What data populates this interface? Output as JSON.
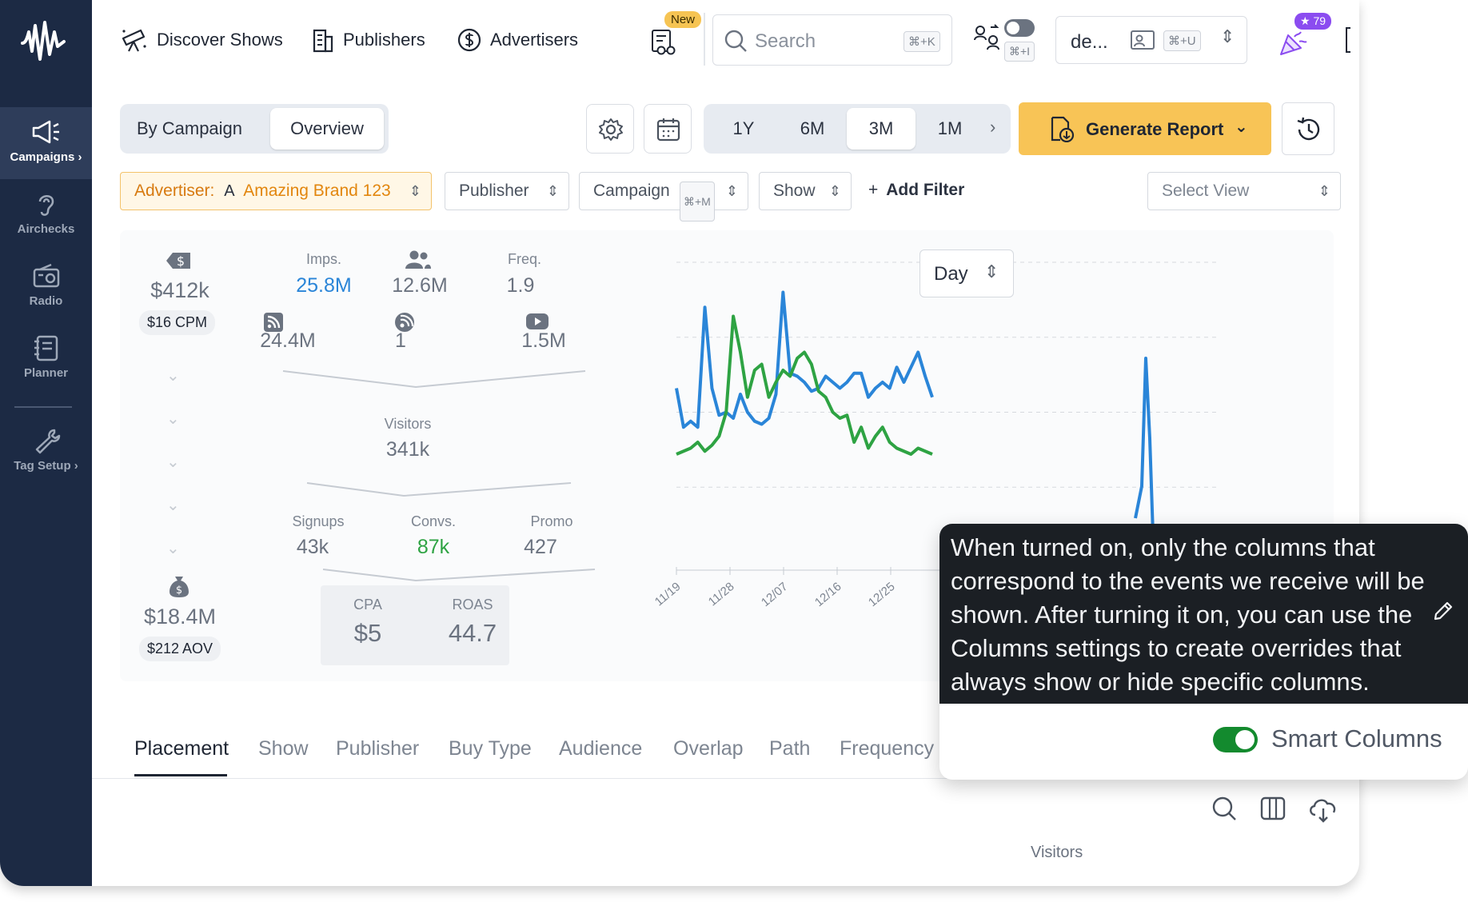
{
  "sidebar": {
    "items": [
      {
        "label": "Campaigns ›",
        "icon": "megaphone-icon",
        "active": true
      },
      {
        "label": "Airchecks",
        "icon": "ear-icon"
      },
      {
        "label": "Radio",
        "icon": "radio-icon"
      },
      {
        "label": "Planner",
        "icon": "planner-icon"
      },
      {
        "label": "Tag Setup ›",
        "icon": "wrench-icon"
      }
    ]
  },
  "topbar": {
    "nav": [
      {
        "label": "Discover Shows",
        "icon": "telescope-icon"
      },
      {
        "label": "Publishers",
        "icon": "building-icon"
      },
      {
        "label": "Advertisers",
        "icon": "dollar-circle-icon"
      }
    ],
    "new_badge": "New",
    "search_placeholder": "Search",
    "search_shortcut": "⌘+K",
    "toggle_shortcut": "⌘+I",
    "account": "de...",
    "account_shortcut": "⌘+U",
    "celebrate_count": "★ 79"
  },
  "controls": {
    "view_tabs": [
      "By Campaign",
      "Overview"
    ],
    "active_view": "Overview",
    "ranges": [
      "1Y",
      "6M",
      "3M",
      "1M"
    ],
    "active_range": "3M",
    "generate_report": "Generate Report"
  },
  "filters": {
    "advertiser_label": "Advertiser:",
    "advertiser_initial": "A",
    "advertiser_value": "Amazing Brand 123",
    "publisher": "Publisher",
    "campaign": "Campaign",
    "campaign_shortcut": "⌘+M",
    "show": "Show",
    "add_filter": "Add Filter",
    "select_view": "Select View"
  },
  "stats": {
    "spend": "$412k",
    "cpm": "$16 CPM",
    "revenue": "$18.4M",
    "aov": "$212 AOV",
    "imps_label": "Imps.",
    "imps": "25.8M",
    "reach": "12.6M",
    "freq_label": "Freq.",
    "freq": "1.9",
    "podcast": "24.4M",
    "streaming": "1",
    "youtube": "1.5M",
    "visitors_label": "Visitors",
    "visitors": "341k",
    "signups_label": "Signups",
    "signups": "43k",
    "convs_label": "Convs.",
    "convs": "87k",
    "promo_label": "Promo",
    "promo": "427",
    "cpa_label": "CPA",
    "cpa": "$5",
    "roas_label": "ROAS",
    "roas": "44.7"
  },
  "chart_data": {
    "type": "line",
    "interval": "Day",
    "x_ticks": [
      "11/19",
      "11/28",
      "12/07",
      "12/16",
      "12/25"
    ],
    "series": [
      {
        "values": [
          0.58,
          0.45,
          0.47,
          0.45,
          0.85,
          0.58,
          0.49,
          0.5,
          0.48,
          0.56,
          0.5,
          0.47,
          0.46,
          0.48,
          0.56,
          0.9,
          0.63,
          0.62,
          0.6,
          0.57,
          0.58,
          0.62,
          0.6,
          0.58,
          0.6,
          0.63,
          0.63,
          0.55,
          0.58,
          0.6,
          0.58,
          0.65,
          0.6,
          0.65,
          0.7,
          0.62,
          0.55
        ],
        "color": "#2a85d8"
      },
      {
        "values": [
          0.36,
          0.37,
          0.38,
          0.4,
          0.37,
          0.39,
          0.42,
          0.5,
          0.82,
          0.7,
          0.55,
          0.64,
          0.66,
          0.55,
          0.6,
          0.64,
          0.62,
          0.68,
          0.7,
          0.66,
          0.57,
          0.55,
          0.5,
          0.48,
          0.49,
          0.4,
          0.45,
          0.38,
          0.42,
          0.45,
          0.4,
          0.38,
          0.37,
          0.36,
          0.38,
          0.37,
          0.36
        ],
        "color": "#2ea343"
      }
    ],
    "grid": true
  },
  "tabs": [
    "Placement",
    "Show",
    "Publisher",
    "Buy Type",
    "Audience",
    "Overlap",
    "Path",
    "Frequency"
  ],
  "active_tab": "Placement",
  "table": {
    "first_visible_header": "Visitors"
  },
  "popover": {
    "text": "When turned on, only the columns that correspond to the events we receive will be shown. After turning it on, you can use the Columns settings to create overrides that always show or hide specific columns.",
    "toggle_label": "Smart Columns",
    "toggle_on": true
  }
}
